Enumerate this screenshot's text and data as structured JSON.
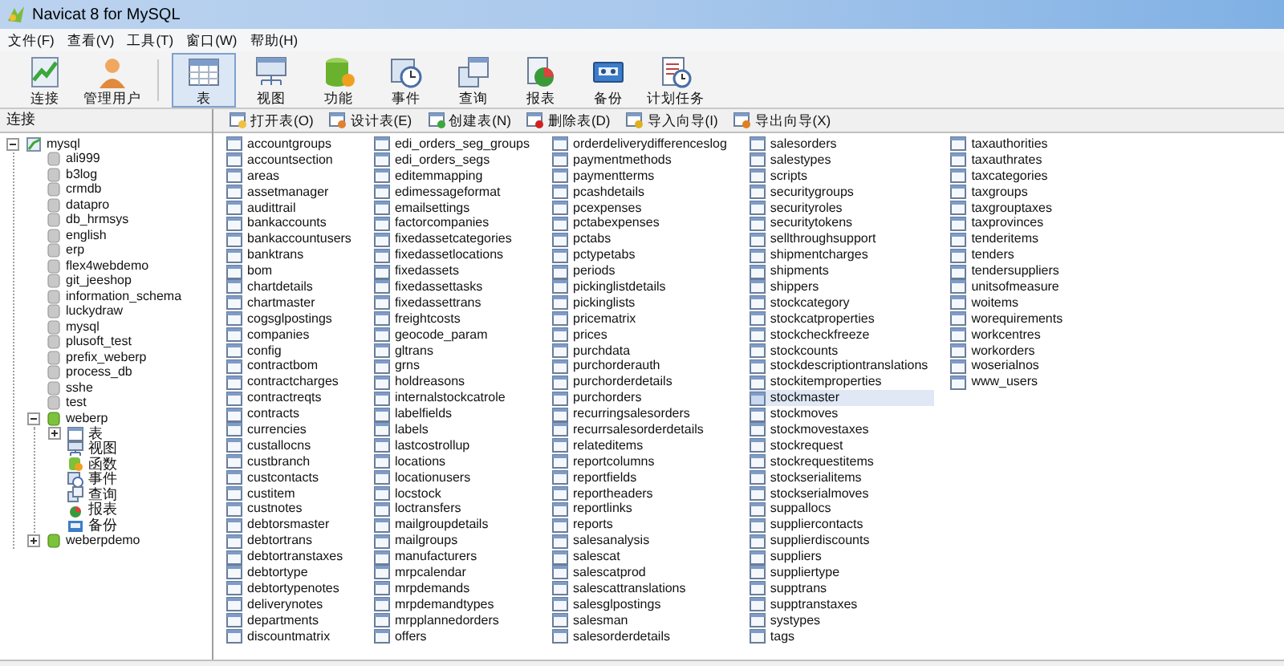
{
  "window": {
    "title": "Navicat 8 for MySQL"
  },
  "menu": [
    "文件(F)",
    "查看(V)",
    "工具(T)",
    "窗口(W)",
    "帮助(H)"
  ],
  "toolbar": [
    {
      "label": "连接",
      "kind": "connect",
      "selected": false
    },
    {
      "label": "管理用户",
      "kind": "user",
      "selected": false
    },
    {
      "label": "表",
      "kind": "table",
      "selected": true
    },
    {
      "label": "视图",
      "kind": "view",
      "selected": false
    },
    {
      "label": "功能",
      "kind": "function",
      "selected": false
    },
    {
      "label": "事件",
      "kind": "event",
      "selected": false
    },
    {
      "label": "查询",
      "kind": "query",
      "selected": false
    },
    {
      "label": "报表",
      "kind": "report",
      "selected": false
    },
    {
      "label": "备份",
      "kind": "backup",
      "selected": false
    },
    {
      "label": "计划任务",
      "kind": "schedule",
      "selected": false
    }
  ],
  "sidebar": {
    "header": "连接",
    "tree": [
      {
        "label": "mysql",
        "kind": "connection",
        "expanded": true,
        "children": [
          {
            "label": "ali999",
            "kind": "database",
            "open": false
          },
          {
            "label": "b3log",
            "kind": "database",
            "open": false
          },
          {
            "label": "crmdb",
            "kind": "database",
            "open": false
          },
          {
            "label": "datapro",
            "kind": "database",
            "open": false
          },
          {
            "label": "db_hrmsys",
            "kind": "database",
            "open": false
          },
          {
            "label": "english",
            "kind": "database",
            "open": false
          },
          {
            "label": "erp",
            "kind": "database",
            "open": false
          },
          {
            "label": "flex4webdemo",
            "kind": "database",
            "open": false
          },
          {
            "label": "git_jeeshop",
            "kind": "database",
            "open": false
          },
          {
            "label": "information_schema",
            "kind": "database",
            "open": false
          },
          {
            "label": "luckydraw",
            "kind": "database",
            "open": false
          },
          {
            "label": "mysql",
            "kind": "database",
            "open": false
          },
          {
            "label": "plusoft_test",
            "kind": "database",
            "open": false
          },
          {
            "label": "prefix_weberp",
            "kind": "database",
            "open": false
          },
          {
            "label": "process_db",
            "kind": "database",
            "open": false
          },
          {
            "label": "sshe",
            "kind": "database",
            "open": false
          },
          {
            "label": "test",
            "kind": "database",
            "open": false
          },
          {
            "label": "weberp",
            "kind": "database",
            "open": true,
            "expanded": true,
            "children": [
              {
                "label": "表",
                "kind": "tables",
                "expanded": false
              },
              {
                "label": "视图",
                "kind": "views"
              },
              {
                "label": "函数",
                "kind": "functions"
              },
              {
                "label": "事件",
                "kind": "events"
              },
              {
                "label": "查询",
                "kind": "queries"
              },
              {
                "label": "报表",
                "kind": "reports"
              },
              {
                "label": "备份",
                "kind": "backups"
              }
            ]
          },
          {
            "label": "weberpdemo",
            "kind": "database",
            "open": true,
            "expanded": false
          }
        ]
      }
    ]
  },
  "object_toolbar": [
    {
      "label": "打开表(O)",
      "kind": "open"
    },
    {
      "label": "设计表(E)",
      "kind": "design"
    },
    {
      "label": "创建表(N)",
      "kind": "create"
    },
    {
      "label": "删除表(D)",
      "kind": "delete"
    },
    {
      "label": "导入向导(I)",
      "kind": "import"
    },
    {
      "label": "导出向导(X)",
      "kind": "export"
    }
  ],
  "tables": [
    {
      "name": "accountgroups",
      "selected": false
    },
    {
      "name": "accountsection",
      "selected": false
    },
    {
      "name": "areas",
      "selected": false
    },
    {
      "name": "assetmanager",
      "selected": false
    },
    {
      "name": "audittrail",
      "selected": false
    },
    {
      "name": "bankaccounts",
      "selected": false
    },
    {
      "name": "bankaccountusers",
      "selected": false
    },
    {
      "name": "banktrans",
      "selected": false
    },
    {
      "name": "bom",
      "selected": false
    },
    {
      "name": "chartdetails",
      "selected": false
    },
    {
      "name": "chartmaster",
      "selected": false
    },
    {
      "name": "cogsglpostings",
      "selected": false
    },
    {
      "name": "companies",
      "selected": false
    },
    {
      "name": "config",
      "selected": false
    },
    {
      "name": "contractbom",
      "selected": false
    },
    {
      "name": "contractcharges",
      "selected": false
    },
    {
      "name": "contractreqts",
      "selected": false
    },
    {
      "name": "contracts",
      "selected": false
    },
    {
      "name": "currencies",
      "selected": false
    },
    {
      "name": "custallocns",
      "selected": false
    },
    {
      "name": "custbranch",
      "selected": false
    },
    {
      "name": "custcontacts",
      "selected": false
    },
    {
      "name": "custitem",
      "selected": false
    },
    {
      "name": "custnotes",
      "selected": false
    },
    {
      "name": "debtorsmaster",
      "selected": false
    },
    {
      "name": "debtortrans",
      "selected": false
    },
    {
      "name": "debtortranstaxes",
      "selected": false
    },
    {
      "name": "debtortype",
      "selected": false
    },
    {
      "name": "debtortypenotes",
      "selected": false
    },
    {
      "name": "deliverynotes",
      "selected": false
    },
    {
      "name": "departments",
      "selected": false
    },
    {
      "name": "discountmatrix",
      "selected": false
    },
    {
      "name": "edi_orders_seg_groups",
      "selected": false
    },
    {
      "name": "edi_orders_segs",
      "selected": false
    },
    {
      "name": "editemmapping",
      "selected": false
    },
    {
      "name": "edimessageformat",
      "selected": false
    },
    {
      "name": "emailsettings",
      "selected": false
    },
    {
      "name": "factorcompanies",
      "selected": false
    },
    {
      "name": "fixedassetcategories",
      "selected": false
    },
    {
      "name": "fixedassetlocations",
      "selected": false
    },
    {
      "name": "fixedassets",
      "selected": false
    },
    {
      "name": "fixedassettasks",
      "selected": false
    },
    {
      "name": "fixedassettrans",
      "selected": false
    },
    {
      "name": "freightcosts",
      "selected": false
    },
    {
      "name": "geocode_param",
      "selected": false
    },
    {
      "name": "gltrans",
      "selected": false
    },
    {
      "name": "grns",
      "selected": false
    },
    {
      "name": "holdreasons",
      "selected": false
    },
    {
      "name": "internalstockcatrole",
      "selected": false
    },
    {
      "name": "labelfields",
      "selected": false
    },
    {
      "name": "labels",
      "selected": false
    },
    {
      "name": "lastcostrollup",
      "selected": false
    },
    {
      "name": "locations",
      "selected": false
    },
    {
      "name": "locationusers",
      "selected": false
    },
    {
      "name": "locstock",
      "selected": false
    },
    {
      "name": "loctransfers",
      "selected": false
    },
    {
      "name": "mailgroupdetails",
      "selected": false
    },
    {
      "name": "mailgroups",
      "selected": false
    },
    {
      "name": "manufacturers",
      "selected": false
    },
    {
      "name": "mrpcalendar",
      "selected": false
    },
    {
      "name": "mrpdemands",
      "selected": false
    },
    {
      "name": "mrpdemandtypes",
      "selected": false
    },
    {
      "name": "mrpplannedorders",
      "selected": false
    },
    {
      "name": "offers",
      "selected": false
    },
    {
      "name": "orderdeliverydifferenceslog",
      "selected": false
    },
    {
      "name": "paymentmethods",
      "selected": false
    },
    {
      "name": "paymentterms",
      "selected": false
    },
    {
      "name": "pcashdetails",
      "selected": false
    },
    {
      "name": "pcexpenses",
      "selected": false
    },
    {
      "name": "pctabexpenses",
      "selected": false
    },
    {
      "name": "pctabs",
      "selected": false
    },
    {
      "name": "pctypetabs",
      "selected": false
    },
    {
      "name": "periods",
      "selected": false
    },
    {
      "name": "pickinglistdetails",
      "selected": false
    },
    {
      "name": "pickinglists",
      "selected": false
    },
    {
      "name": "pricematrix",
      "selected": false
    },
    {
      "name": "prices",
      "selected": false
    },
    {
      "name": "purchdata",
      "selected": false
    },
    {
      "name": "purchorderauth",
      "selected": false
    },
    {
      "name": "purchorderdetails",
      "selected": false
    },
    {
      "name": "purchorders",
      "selected": false
    },
    {
      "name": "recurringsalesorders",
      "selected": false
    },
    {
      "name": "recurrsalesorderdetails",
      "selected": false
    },
    {
      "name": "relateditems",
      "selected": false
    },
    {
      "name": "reportcolumns",
      "selected": false
    },
    {
      "name": "reportfields",
      "selected": false
    },
    {
      "name": "reportheaders",
      "selected": false
    },
    {
      "name": "reportlinks",
      "selected": false
    },
    {
      "name": "reports",
      "selected": false
    },
    {
      "name": "salesanalysis",
      "selected": false
    },
    {
      "name": "salescat",
      "selected": false
    },
    {
      "name": "salescatprod",
      "selected": false
    },
    {
      "name": "salescattranslations",
      "selected": false
    },
    {
      "name": "salesglpostings",
      "selected": false
    },
    {
      "name": "salesman",
      "selected": false
    },
    {
      "name": "salesorderdetails",
      "selected": false
    },
    {
      "name": "salesorders",
      "selected": false
    },
    {
      "name": "salestypes",
      "selected": false
    },
    {
      "name": "scripts",
      "selected": false
    },
    {
      "name": "securitygroups",
      "selected": false
    },
    {
      "name": "securityroles",
      "selected": false
    },
    {
      "name": "securitytokens",
      "selected": false
    },
    {
      "name": "sellthroughsupport",
      "selected": false
    },
    {
      "name": "shipmentcharges",
      "selected": false
    },
    {
      "name": "shipments",
      "selected": false
    },
    {
      "name": "shippers",
      "selected": false
    },
    {
      "name": "stockcategory",
      "selected": false
    },
    {
      "name": "stockcatproperties",
      "selected": false
    },
    {
      "name": "stockcheckfreeze",
      "selected": false
    },
    {
      "name": "stockcounts",
      "selected": false
    },
    {
      "name": "stockdescriptiontranslations",
      "selected": false
    },
    {
      "name": "stockitemproperties",
      "selected": false
    },
    {
      "name": "stockmaster",
      "selected": true
    },
    {
      "name": "stockmoves",
      "selected": false
    },
    {
      "name": "stockmovestaxes",
      "selected": false
    },
    {
      "name": "stockrequest",
      "selected": false
    },
    {
      "name": "stockrequestitems",
      "selected": false
    },
    {
      "name": "stockserialitems",
      "selected": false
    },
    {
      "name": "stockserialmoves",
      "selected": false
    },
    {
      "name": "suppallocs",
      "selected": false
    },
    {
      "name": "suppliercontacts",
      "selected": false
    },
    {
      "name": "supplierdiscounts",
      "selected": false
    },
    {
      "name": "suppliers",
      "selected": false
    },
    {
      "name": "suppliertype",
      "selected": false
    },
    {
      "name": "supptrans",
      "selected": false
    },
    {
      "name": "supptranstaxes",
      "selected": false
    },
    {
      "name": "systypes",
      "selected": false
    },
    {
      "name": "tags",
      "selected": false
    },
    {
      "name": "taxauthorities",
      "selected": false
    },
    {
      "name": "taxauthrates",
      "selected": false
    },
    {
      "name": "taxcategories",
      "selected": false
    },
    {
      "name": "taxgroups",
      "selected": false
    },
    {
      "name": "taxgrouptaxes",
      "selected": false
    },
    {
      "name": "taxprovinces",
      "selected": false
    },
    {
      "name": "tenderitems",
      "selected": false
    },
    {
      "name": "tenders",
      "selected": false
    },
    {
      "name": "tendersuppliers",
      "selected": false
    },
    {
      "name": "unitsofmeasure",
      "selected": false
    },
    {
      "name": "woitems",
      "selected": false
    },
    {
      "name": "worequirements",
      "selected": false
    },
    {
      "name": "workcentres",
      "selected": false
    },
    {
      "name": "workorders",
      "selected": false
    },
    {
      "name": "woserialnos",
      "selected": false
    },
    {
      "name": "www_users",
      "selected": false
    }
  ]
}
